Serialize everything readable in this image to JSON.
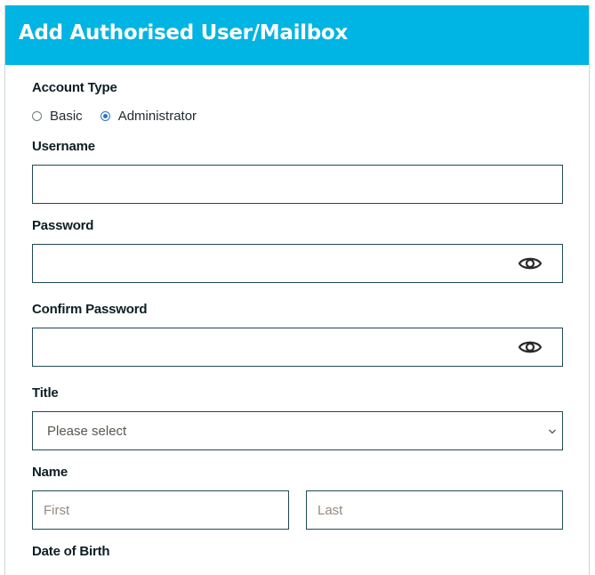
{
  "header": {
    "title": "Add Authorised User/Mailbox"
  },
  "account_type": {
    "label": "Account Type",
    "options": [
      {
        "label": "Basic",
        "selected": false
      },
      {
        "label": "Administrator",
        "selected": true
      }
    ]
  },
  "username": {
    "label": "Username",
    "value": ""
  },
  "password": {
    "label": "Password",
    "value": "",
    "toggle_icon": "eye-icon"
  },
  "confirm_password": {
    "label": "Confirm Password",
    "value": "",
    "toggle_icon": "eye-icon"
  },
  "title_field": {
    "label": "Title",
    "selected": "Please select"
  },
  "name": {
    "label": "Name",
    "first_placeholder": "First",
    "last_placeholder": "Last"
  },
  "date_of_birth": {
    "label": "Date of Birth"
  },
  "colors": {
    "header_bg": "#00b4e3",
    "border": "#1f4a52",
    "radio_accent": "#2b73c8"
  }
}
